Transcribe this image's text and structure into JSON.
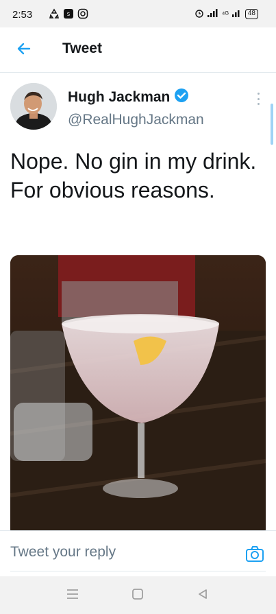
{
  "status_bar": {
    "time": "2:53",
    "network": "⁴ᴳ",
    "battery": "48",
    "icons": [
      "recycle-icon",
      "app-badge-icon",
      "instagram-icon",
      "alarm-icon",
      "signal-icon",
      "signal-4g-icon",
      "battery-icon"
    ]
  },
  "header": {
    "title": "Tweet",
    "back_icon": "arrow-left-icon"
  },
  "tweet": {
    "author_name": "Hugh Jackman",
    "verified_icon": "verified-badge-icon",
    "handle": "@RealHughJackman",
    "text": "Nope. No gin in my drink. For obvious reasons.",
    "media_description_icon": "photo-martini-glass",
    "more_icon": "more-vertical-icon"
  },
  "reply": {
    "placeholder": "Tweet your reply",
    "camera_icon": "camera-icon"
  },
  "nav": {
    "icons": [
      "menu-icon",
      "home-square-icon",
      "back-triangle-icon"
    ]
  },
  "colors": {
    "accent": "#1da1f2",
    "text": "#14171a",
    "secondary": "#657786",
    "divider": "#e1e8ed"
  }
}
